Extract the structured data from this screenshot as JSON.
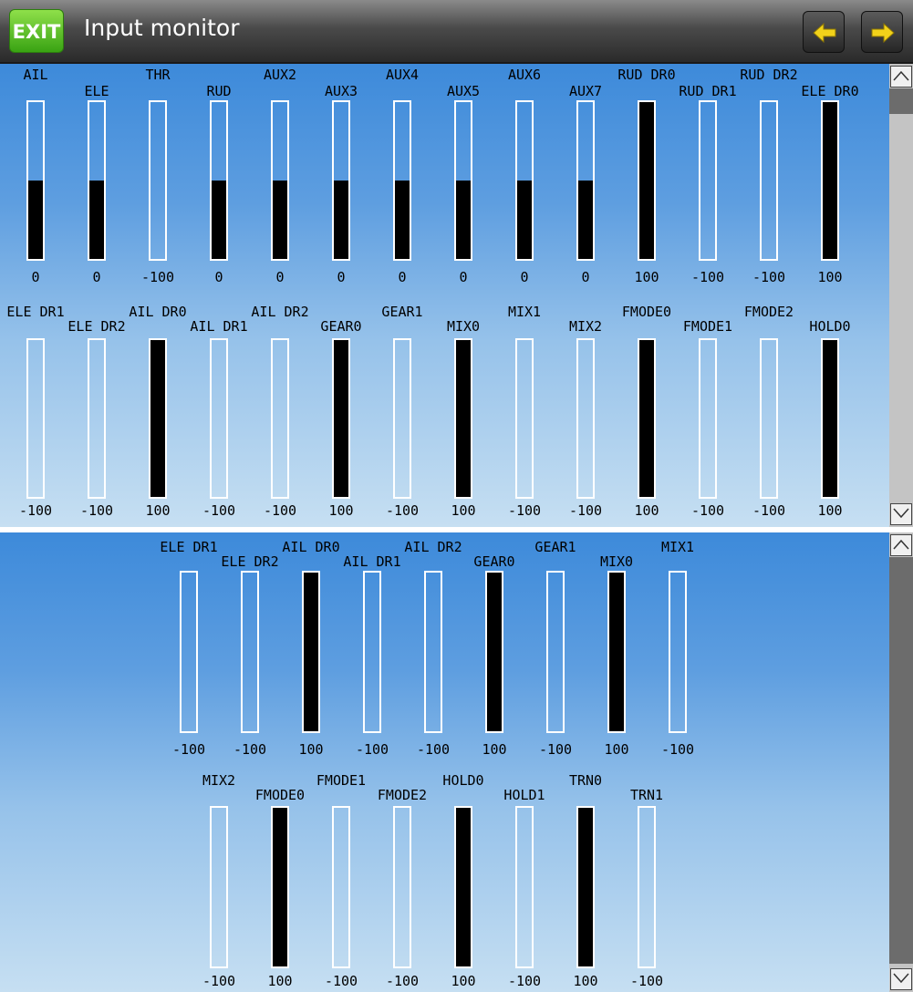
{
  "header": {
    "exit_label": "EXIT",
    "title": "Input monitor",
    "prev_icon": "arrow-left-icon",
    "next_icon": "arrow-right-icon",
    "accent_green": "#4fc21f",
    "arrow_yellow": "#f2d21a"
  },
  "colors": {
    "bar_fill": "#000000",
    "bar_outline": "#ffffff",
    "background_top": "#3d8ada",
    "background_bottom": "#c6dff2",
    "scrollbar_track": "#c4c4c4",
    "scrollbar_thumb": "#6c6c6c"
  },
  "screens": [
    {
      "rows": [
        {
          "channels": [
            {
              "label": "AIL",
              "value": "0",
              "level": 0.5
            },
            {
              "label": "ELE",
              "value": "0",
              "level": 0.5
            },
            {
              "label": "THR",
              "value": "-100",
              "level": 0
            },
            {
              "label": "RUD",
              "value": "0",
              "level": 0.5
            },
            {
              "label": "AUX2",
              "value": "0",
              "level": 0.5
            },
            {
              "label": "AUX3",
              "value": "0",
              "level": 0.5
            },
            {
              "label": "AUX4",
              "value": "0",
              "level": 0.5
            },
            {
              "label": "AUX5",
              "value": "0",
              "level": 0.5
            },
            {
              "label": "AUX6",
              "value": "0",
              "level": 0.5
            },
            {
              "label": "AUX7",
              "value": "0",
              "level": 0.5
            },
            {
              "label": "RUD DR0",
              "value": "100",
              "level": 1
            },
            {
              "label": "RUD DR1",
              "value": "-100",
              "level": 0
            },
            {
              "label": "RUD DR2",
              "value": "-100",
              "level": 0
            },
            {
              "label": "ELE DR0",
              "value": "100",
              "level": 1
            }
          ]
        },
        {
          "channels": [
            {
              "label": "ELE DR1",
              "value": "-100",
              "level": 0
            },
            {
              "label": "ELE DR2",
              "value": "-100",
              "level": 0
            },
            {
              "label": "AIL DR0",
              "value": "100",
              "level": 1
            },
            {
              "label": "AIL DR1",
              "value": "-100",
              "level": 0
            },
            {
              "label": "AIL DR2",
              "value": "-100",
              "level": 0
            },
            {
              "label": "GEAR0",
              "value": "100",
              "level": 1
            },
            {
              "label": "GEAR1",
              "value": "-100",
              "level": 0
            },
            {
              "label": "MIX0",
              "value": "100",
              "level": 1
            },
            {
              "label": "MIX1",
              "value": "-100",
              "level": 0
            },
            {
              "label": "MIX2",
              "value": "-100",
              "level": 0
            },
            {
              "label": "FMODE0",
              "value": "100",
              "level": 1
            },
            {
              "label": "FMODE1",
              "value": "-100",
              "level": 0
            },
            {
              "label": "FMODE2",
              "value": "-100",
              "level": 0
            },
            {
              "label": "HOLD0",
              "value": "100",
              "level": 1
            }
          ]
        }
      ]
    },
    {
      "rows": [
        {
          "channels": [
            {
              "label": "ELE DR1",
              "value": "-100",
              "level": 0
            },
            {
              "label": "ELE DR2",
              "value": "-100",
              "level": 0
            },
            {
              "label": "AIL DR0",
              "value": "100",
              "level": 1
            },
            {
              "label": "AIL DR1",
              "value": "-100",
              "level": 0
            },
            {
              "label": "AIL DR2",
              "value": "-100",
              "level": 0
            },
            {
              "label": "GEAR0",
              "value": "100",
              "level": 1
            },
            {
              "label": "GEAR1",
              "value": "-100",
              "level": 0
            },
            {
              "label": "MIX0",
              "value": "100",
              "level": 1
            },
            {
              "label": "MIX1",
              "value": "-100",
              "level": 0
            }
          ]
        },
        {
          "channels": [
            {
              "label": "MIX2",
              "value": "-100",
              "level": 0
            },
            {
              "label": "FMODE0",
              "value": "100",
              "level": 1
            },
            {
              "label": "FMODE1",
              "value": "-100",
              "level": 0
            },
            {
              "label": "FMODE2",
              "value": "-100",
              "level": 0
            },
            {
              "label": "HOLD0",
              "value": "100",
              "level": 1
            },
            {
              "label": "HOLD1",
              "value": "-100",
              "level": 0
            },
            {
              "label": "TRN0",
              "value": "100",
              "level": 1
            },
            {
              "label": "TRN1",
              "value": "-100",
              "level": 0
            }
          ]
        }
      ]
    }
  ]
}
